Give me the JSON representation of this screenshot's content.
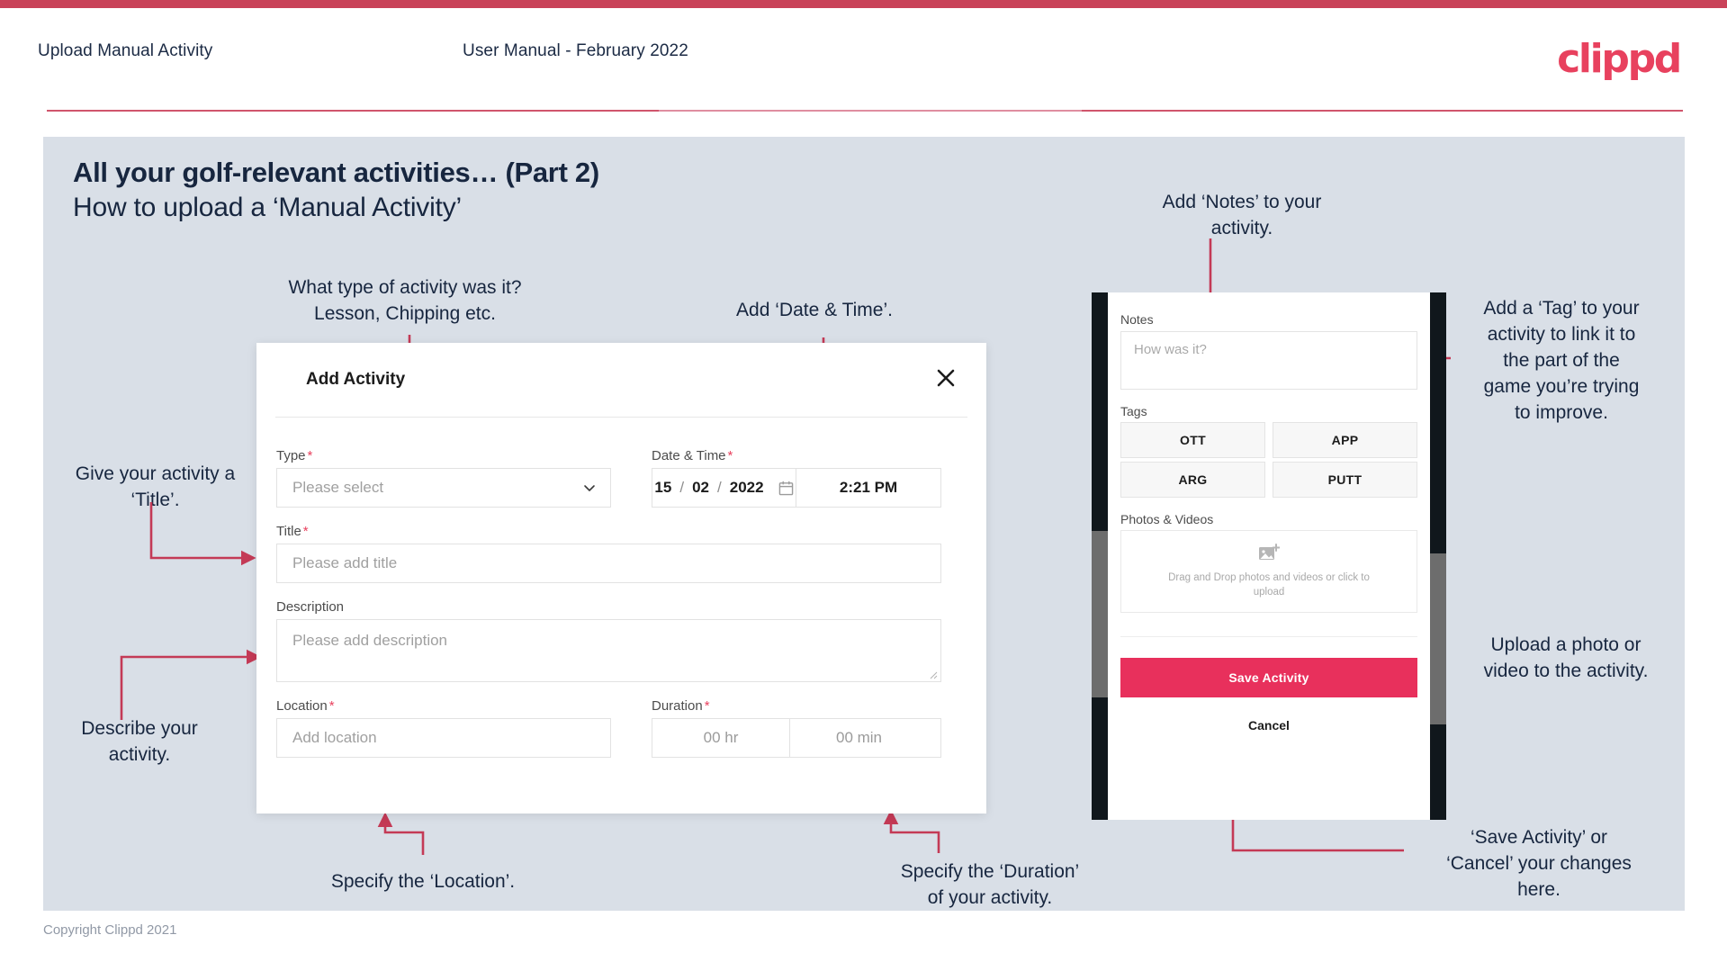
{
  "header": {
    "left_title": "Upload Manual Activity",
    "center_title": "User Manual - February 2022",
    "logo": "clippd"
  },
  "slide": {
    "heading": "All your golf-relevant activities… (Part 2)",
    "subheading": "How to upload a ‘Manual Activity’"
  },
  "footer": {
    "copyright": "Copyright Clippd 2021"
  },
  "dialog": {
    "title": "Add Activity",
    "close_icon": "close-icon",
    "type": {
      "label": "Type",
      "required": "*",
      "value": "Please select",
      "chevron": "chevron-down-icon"
    },
    "datetime": {
      "label": "Date & Time",
      "required": "*",
      "day": "15",
      "month": "02",
      "year": "2022",
      "sep": "/",
      "calendar_icon": "calendar-icon",
      "time": "2:21 PM"
    },
    "title_field": {
      "label": "Title",
      "required": "*",
      "placeholder": "Please add title"
    },
    "description": {
      "label": "Description",
      "placeholder": "Please add description"
    },
    "location": {
      "label": "Location",
      "required": "*",
      "placeholder": "Add location"
    },
    "duration": {
      "label": "Duration",
      "required": "*",
      "hours": "00 hr",
      "minutes": "00 min"
    }
  },
  "phone": {
    "notes": {
      "label": "Notes",
      "placeholder": "How was it?"
    },
    "tags": {
      "label": "Tags",
      "items": [
        "OTT",
        "APP",
        "ARG",
        "PUTT"
      ]
    },
    "photos": {
      "label": "Photos & Videos",
      "icon": "add-image-icon",
      "hint": "Drag and Drop photos and videos or click to upload"
    },
    "save_label": "Save Activity",
    "cancel_label": "Cancel"
  },
  "annotations": {
    "type": "What type of activity was it?\nLesson, Chipping etc.",
    "datetime": "Add ‘Date & Time’.",
    "title": "Give your activity a\n‘Title’.",
    "description": "Describe your\nactivity.",
    "location": "Specify the ‘Location’.",
    "duration": "Specify the ‘Duration’\nof your activity.",
    "notes": "Add ‘Notes’ to your\nactivity.",
    "tags": "Add a ‘Tag’ to your\nactivity to link it to\nthe part of the\ngame you’re trying\nto improve.",
    "upload": "Upload a photo or\nvideo to the activity.",
    "save": "‘Save Activity’ or\n‘Cancel’ your changes\nhere."
  },
  "colors": {
    "brand_pink": "#e8415e",
    "accent_line": "#c94259",
    "slide_bg": "#d9dfe7",
    "text_dark": "#17263f",
    "save_button": "#e8305c"
  }
}
